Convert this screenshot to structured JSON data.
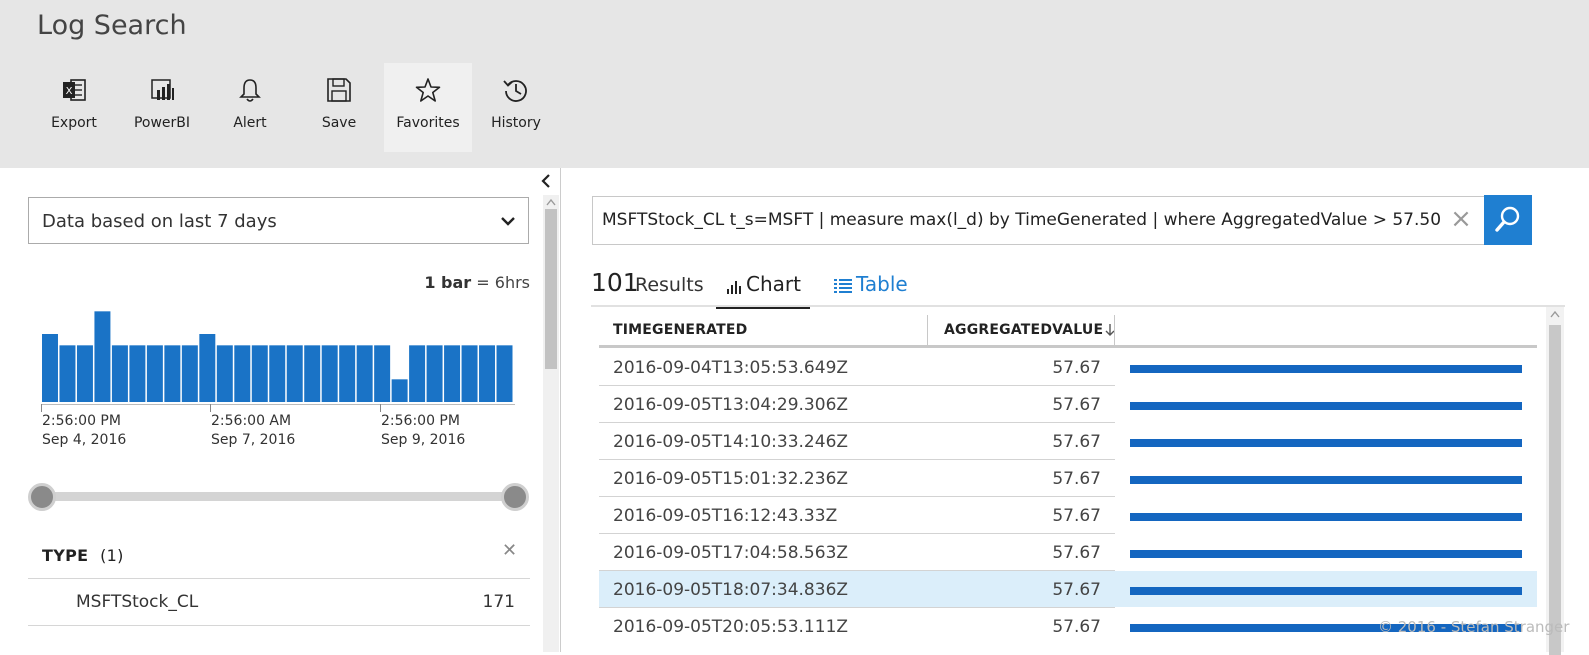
{
  "app": {
    "title": "Log Search"
  },
  "toolbar": [
    {
      "label": "Export",
      "icon": "excel-icon"
    },
    {
      "label": "PowerBI",
      "icon": "powerbi-icon"
    },
    {
      "label": "Alert",
      "icon": "bell-icon"
    },
    {
      "label": "Save",
      "icon": "save-icon"
    },
    {
      "label": "Favorites",
      "icon": "star-icon",
      "active": true
    },
    {
      "label": "History",
      "icon": "history-icon"
    }
  ],
  "filter": {
    "range_label": "Data based on last 7 days",
    "bar_legend_bold": "1 bar",
    "bar_legend_rest": " = 6hrs",
    "ticks": [
      {
        "time": "2:56:00 PM",
        "date": "Sep 4, 2016"
      },
      {
        "time": "2:56:00 AM",
        "date": "Sep 7, 2016"
      },
      {
        "time": "2:56:00 PM",
        "date": "Sep 9, 2016"
      }
    ],
    "type_heading": "TYPE",
    "type_count": "(1)",
    "type_items": [
      {
        "name": "MSFTStock_CL",
        "count": "171"
      }
    ]
  },
  "chart_data": {
    "type": "bar",
    "values": [
      6,
      5,
      5,
      8,
      5,
      5,
      5,
      5,
      5,
      6,
      5,
      5,
      5,
      5,
      5,
      5,
      5,
      5,
      5,
      5,
      2,
      5,
      5,
      5,
      5,
      5,
      5
    ],
    "ylim": [
      0,
      9
    ],
    "color": "#1a73c6"
  },
  "query": {
    "text": "MSFTStock_CL t_s=MSFT | measure max(l_d) by TimeGenerated | where AggregatedValue > 57.50"
  },
  "results": {
    "count": "101",
    "label": "Results",
    "tabs": {
      "chart": "Chart",
      "table": "Table"
    },
    "columns": {
      "time": "TIMEGENERATED",
      "value": "AGGREGATEDVALUE"
    },
    "rows": [
      {
        "time": "2016-09-04T13:05:53.649Z",
        "value": "57.67"
      },
      {
        "time": "2016-09-05T13:04:29.306Z",
        "value": "57.67"
      },
      {
        "time": "2016-09-05T14:10:33.246Z",
        "value": "57.67"
      },
      {
        "time": "2016-09-05T15:01:32.236Z",
        "value": "57.67"
      },
      {
        "time": "2016-09-05T16:12:43.33Z",
        "value": "57.67"
      },
      {
        "time": "2016-09-05T17:04:58.563Z",
        "value": "57.67"
      },
      {
        "time": "2016-09-05T18:07:34.836Z",
        "value": "57.67",
        "selected": true
      },
      {
        "time": "2016-09-05T20:05:53.111Z",
        "value": "57.67"
      }
    ]
  },
  "watermark": "© 2016 - Stefan Stranger",
  "colors": {
    "accent": "#1f7fd1",
    "bar": "#1466c0",
    "selected_row": "#dbeefa"
  }
}
